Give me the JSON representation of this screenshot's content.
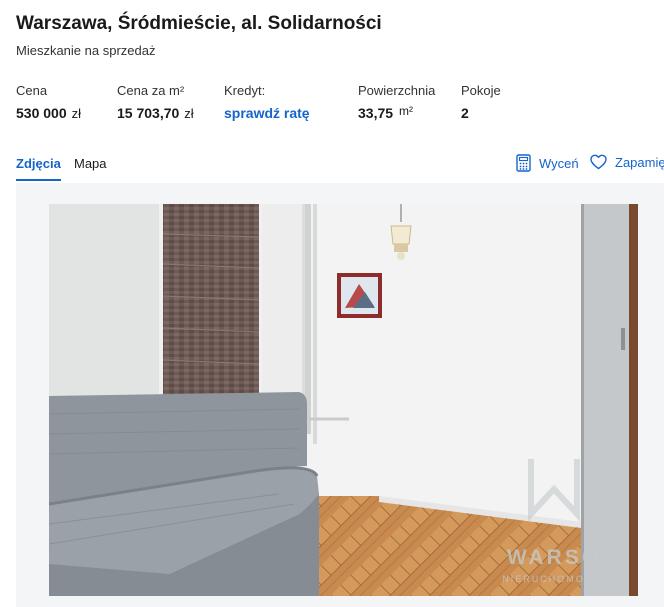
{
  "listing": {
    "title": "Warszawa, Śródmieście, al. Solidarności",
    "subtitle": "Mieszkanie na sprzedaż"
  },
  "stats": {
    "price": {
      "label": "Cena",
      "value": "530 000",
      "unit": "zł"
    },
    "price_per_m2": {
      "label": "Cena za m²",
      "value": "15 703,70",
      "unit": "zł"
    },
    "credit": {
      "label": "Kredyt:",
      "link": "sprawdź ratę"
    },
    "area": {
      "label": "Powierzchnia",
      "value": "33,75",
      "unit": "m²"
    },
    "rooms": {
      "label": "Pokoje",
      "value": "2"
    }
  },
  "tabs": [
    {
      "label": "Zdjęcia",
      "active": true
    },
    {
      "label": "Mapa",
      "active": false
    }
  ],
  "actions": {
    "valuate": {
      "label": "Wyceń",
      "icon": "calculator-icon"
    },
    "save": {
      "label": "Zapamiętaj",
      "icon": "heart-icon"
    }
  },
  "photo": {
    "watermark_brand": "WARSO",
    "watermark_sub": "NIERUCHOMOŚCI"
  },
  "colors": {
    "accent": "#1464cc"
  }
}
